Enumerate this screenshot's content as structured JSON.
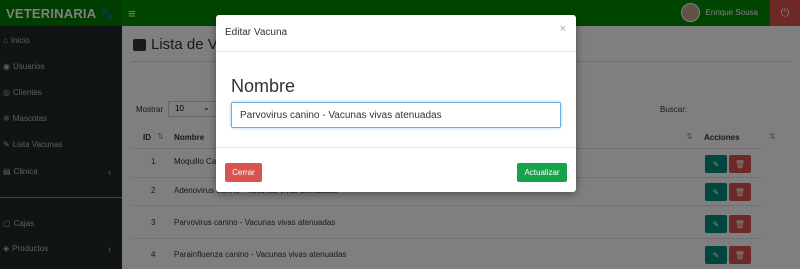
{
  "navbar": {
    "brand": "VETERINARIA",
    "brand_icon": "paw-icon",
    "menu_icon": "hamburger-icon",
    "user_name": "Enrique Sousa",
    "logout_icon": "power-icon"
  },
  "sidebar": {
    "items": [
      {
        "label": "Inicio",
        "icon": "home-icon"
      },
      {
        "label": "Usuarios",
        "icon": "user-icon"
      },
      {
        "label": "Clientes",
        "icon": "users-icon"
      },
      {
        "label": "Mascotas",
        "icon": "paw-icon"
      },
      {
        "label": "Lista Vacunas",
        "icon": "syringe-icon"
      },
      {
        "label": "Clinica",
        "icon": "clinic-icon",
        "chevron": "‹"
      },
      {
        "label": "Cajas",
        "icon": "box-icon"
      },
      {
        "label": "Productos",
        "icon": "tag-icon",
        "chevron": "‹"
      }
    ]
  },
  "main": {
    "page_title": "Lista de Va",
    "show_label": "Mostrar",
    "length_value": "10",
    "search_label": "Buscar:",
    "table": {
      "headers": {
        "id": "ID",
        "name": "Nombre",
        "actions": "Acciones"
      },
      "rows": [
        {
          "id": "1",
          "name": "Moquillo Ca"
        },
        {
          "id": "2",
          "name": "Adenovirus canino - Vacunas vivas atenuadas"
        },
        {
          "id": "3",
          "name": "Parvovirus canino - Vacunas vivas atenuadas"
        },
        {
          "id": "4",
          "name": "Parainfluenza canino - Vacunas vivas atenuadas"
        }
      ]
    }
  },
  "modal": {
    "title": "Editar Vacuna",
    "close_symbol": "×",
    "field_label": "Nombre",
    "field_value": "Parvovirus canino - Vacunas vivas atenuadas",
    "cancel_label": "Cerrar",
    "submit_label": "Actualizar"
  },
  "colors": {
    "navbar": "#008a00",
    "sidebar": "#22282a",
    "danger": "#d9534f",
    "success": "#16a34a",
    "edit": "#008a7c"
  }
}
